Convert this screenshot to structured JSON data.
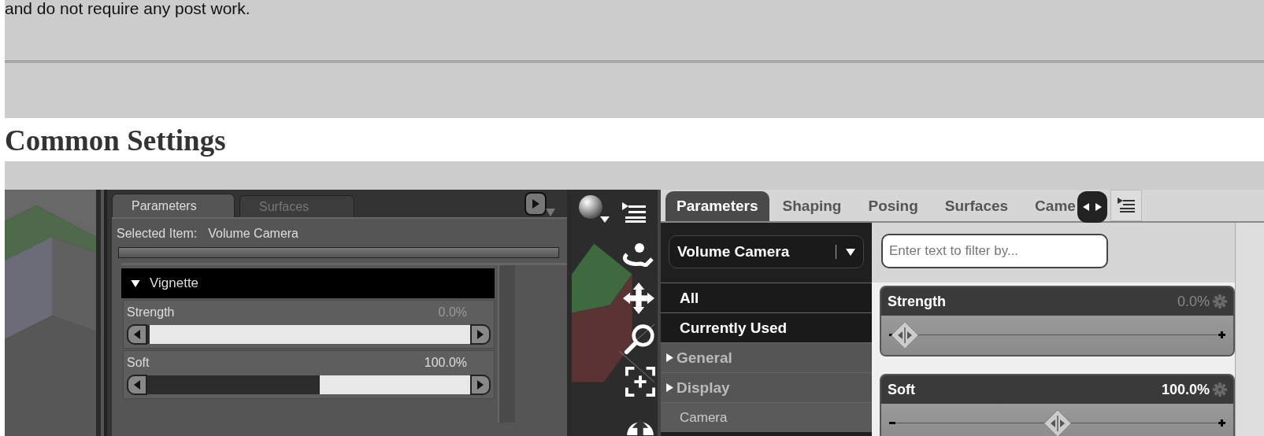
{
  "intro": {
    "text": "and do not require any post work."
  },
  "heading": "Common Settings",
  "old_ui": {
    "tabs": [
      {
        "label": "Parameters",
        "selected": true
      },
      {
        "label": "Surfaces",
        "selected": false
      }
    ],
    "selected_item_label": "Selected Item:",
    "selected_item": "Volume Camera",
    "group": {
      "label": "Vignette",
      "expanded": true
    },
    "params": [
      {
        "name": "Strength",
        "value": "0.0%",
        "at_default": true,
        "level": 0
      },
      {
        "name": "Soft",
        "value": "100.0%",
        "at_default": false,
        "level": 0.53
      }
    ]
  },
  "new_ui": {
    "tabs": [
      {
        "label": "Parameters",
        "selected": true
      },
      {
        "label": "Shaping",
        "selected": false
      },
      {
        "label": "Posing",
        "selected": false
      },
      {
        "label": "Surfaces",
        "selected": false
      },
      {
        "label": "Came",
        "selected": false
      }
    ],
    "node_select": "Volume Camera",
    "categories": [
      {
        "label": "All",
        "kind": "filter"
      },
      {
        "label": "Currently Used",
        "kind": "filter"
      },
      {
        "label": "General",
        "kind": "group",
        "expanded": false
      },
      {
        "label": "Display",
        "kind": "group",
        "expanded": false
      },
      {
        "label": "Camera",
        "kind": "leaf"
      }
    ],
    "filter": {
      "placeholder": "Enter text to filter by..."
    },
    "params": [
      {
        "name": "Strength",
        "value": "0.0%",
        "at_default": true,
        "level": 0
      },
      {
        "name": "Soft",
        "value": "100.0%",
        "at_default": false,
        "level": 0.5
      }
    ]
  }
}
